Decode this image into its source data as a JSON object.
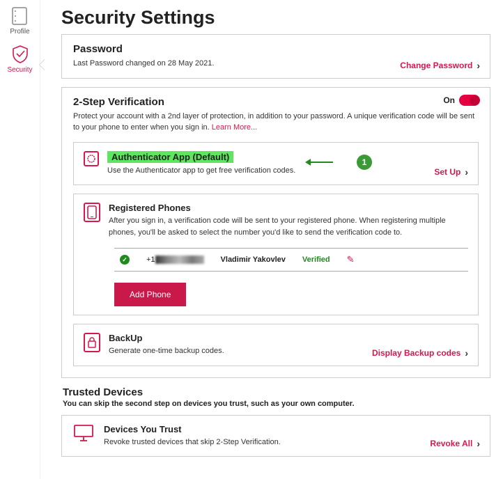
{
  "nav": {
    "profile": "Profile",
    "security": "Security"
  },
  "page_title": "Security Settings",
  "password": {
    "title": "Password",
    "subtitle": "Last Password changed on 28 May 2021.",
    "action": "Change Password"
  },
  "twostep": {
    "title": "2-Step Verification",
    "toggle_label": "On",
    "toggle_state": true,
    "description": "Protect your account with a 2nd layer of protection, in addition to your password. A unique verification code will be sent to your phone to enter when you sign in.",
    "learn_more": "Learn More..."
  },
  "authenticator": {
    "title": "Authenticator App (Default)",
    "subtitle": "Use the Authenticator app to get free verification codes.",
    "action": "Set Up",
    "annotation": "1"
  },
  "phones": {
    "title": "Registered Phones",
    "subtitle": "After you sign in, a verification code will be sent to your registered phone. When registering multiple phones, you'll be asked to select the number you'd like to send the verification code to.",
    "entry": {
      "prefix": "+1",
      "name": "Vladimir Yakovlev",
      "status": "Verified"
    },
    "add_button": "Add Phone"
  },
  "backup": {
    "title": "BackUp",
    "subtitle": "Generate one-time backup codes.",
    "action": "Display Backup codes"
  },
  "trusted": {
    "heading": "Trusted Devices",
    "subheading": "You can skip the second step on devices you trust, such as your own computer.",
    "title": "Devices You Trust",
    "subtitle": "Revoke trusted devices that skip 2-Step Verification.",
    "action": "Revoke All"
  }
}
